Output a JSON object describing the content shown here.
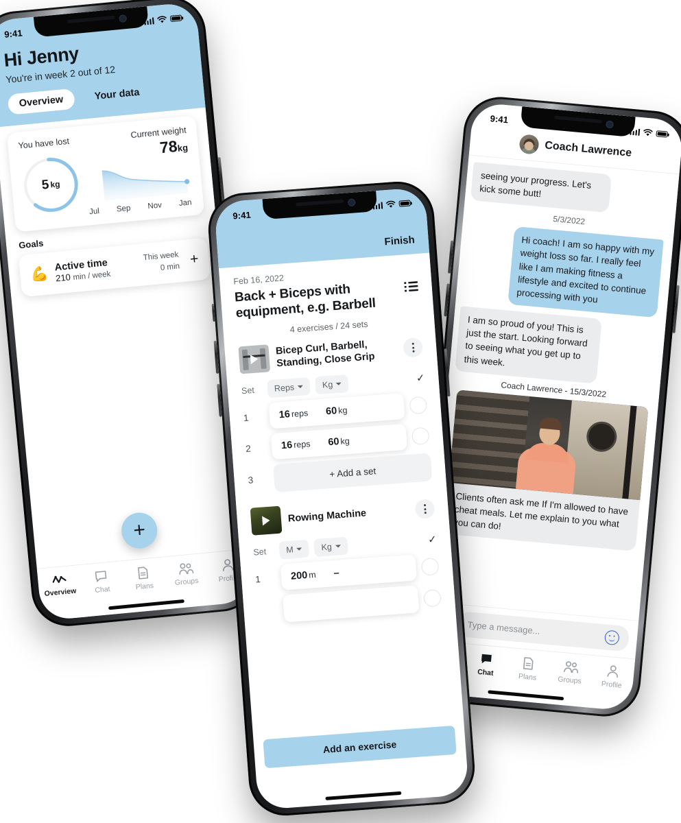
{
  "colors": {
    "accent": "#a6d2ec",
    "ink": "#16191c",
    "muted": "#6b7175",
    "bubble_them": "#ebecee"
  },
  "status_bar": {
    "time": "9:41",
    "signal_icon": "signal-bars-icon",
    "wifi_icon": "wifi-icon",
    "battery_icon": "battery-icon"
  },
  "phone_overview": {
    "greeting": "Hi Jenny",
    "subtitle": "You're in week 2 out of 12",
    "tabs": [
      {
        "label": "Overview",
        "active": true
      },
      {
        "label": "Your data",
        "active": false
      }
    ],
    "weight_card": {
      "lost_label": "You have lost",
      "lost_value": "5",
      "lost_unit": "kg",
      "current_label": "Current weight",
      "current_value": "78",
      "current_unit": "kg"
    },
    "goals_section_title": "Goals",
    "goal": {
      "icon": "flexed-biceps-emoji",
      "title": "Active time",
      "target_value": "210",
      "target_unit": "min / week",
      "period_label": "This week",
      "period_value": "0 min",
      "add_label": "+"
    },
    "fab_label": "+",
    "chart_data": {
      "type": "area",
      "title": "Current weight",
      "categories": [
        "Jul",
        "Sep",
        "Nov",
        "Jan"
      ],
      "x": [
        "Jul",
        "Sep",
        "Nov",
        "Jan"
      ],
      "values": [
        86,
        81,
        79,
        78
      ],
      "ylabel": "kg",
      "xlabel": "",
      "ylim": [
        74,
        88
      ],
      "grid": false,
      "legend": "none",
      "ring": {
        "type": "pie",
        "label": "You have lost",
        "value": 5,
        "unit": "kg",
        "percent_complete": 62
      }
    }
  },
  "phone_workout": {
    "finish_label": "Finish",
    "date": "Feb 16, 2022",
    "title": "Back + Biceps with equipment, e.g. Barbell",
    "list_icon": "list-icon",
    "meta": "4 exercises / 24 sets",
    "column_set_label": "Set",
    "add_exercise_label": "Add an exercise",
    "exercises": [
      {
        "name": "Bicep Curl, Barbell, Standing, Close Grip",
        "thumb": "barbell-curl-thumbnail",
        "unit_primary": "Reps",
        "unit_secondary": "Kg",
        "rows": [
          {
            "num": "1",
            "primary": "16",
            "primary_unit": "reps",
            "secondary": "60",
            "secondary_unit": "kg"
          },
          {
            "num": "2",
            "primary": "16",
            "primary_unit": "reps",
            "secondary": "60",
            "secondary_unit": "kg"
          }
        ],
        "add_set_num": "3",
        "add_set_label": "+ Add a set"
      },
      {
        "name": "Rowing Machine",
        "thumb": "rowing-machine-thumbnail",
        "unit_primary": "M",
        "unit_secondary": "Kg",
        "rows": [
          {
            "num": "1",
            "primary": "200",
            "primary_unit": "m",
            "secondary": "–",
            "secondary_unit": ""
          }
        ]
      }
    ]
  },
  "phone_chat": {
    "contact_name": "Coach Lawrence",
    "avatar": "coach-avatar",
    "messages": [
      {
        "from": "them",
        "text": "seeing your progress. Let's kick some butt!"
      },
      {
        "date": "5/3/2022"
      },
      {
        "from": "me",
        "text": "Hi coach! I am so happy with my weight loss so far. I really feel like I am making fitness a lifestyle and excited to continue processing with you"
      },
      {
        "from": "them",
        "text": "I am so proud of you! This is just the start. Looking forward to seeing what you get up to this week."
      },
      {
        "meta": "Coach Lawrence - 15/3/2022"
      },
      {
        "from": "them",
        "image": "coach-gym-photo",
        "text": "Clients often ask me If I'm allowed to have cheat meals. Let me explain to you what you can do!"
      }
    ],
    "input_placeholder": "Type a message...",
    "image_icon": "image-attach-icon",
    "emoji_icon": "emoji-icon"
  },
  "tabbar": {
    "items": [
      {
        "label": "Overview",
        "icon": "activity-icon"
      },
      {
        "label": "Chat",
        "icon": "chat-bubble-icon"
      },
      {
        "label": "Plans",
        "icon": "document-icon"
      },
      {
        "label": "Groups",
        "icon": "people-icon"
      },
      {
        "label": "Profile",
        "icon": "person-icon"
      }
    ]
  }
}
